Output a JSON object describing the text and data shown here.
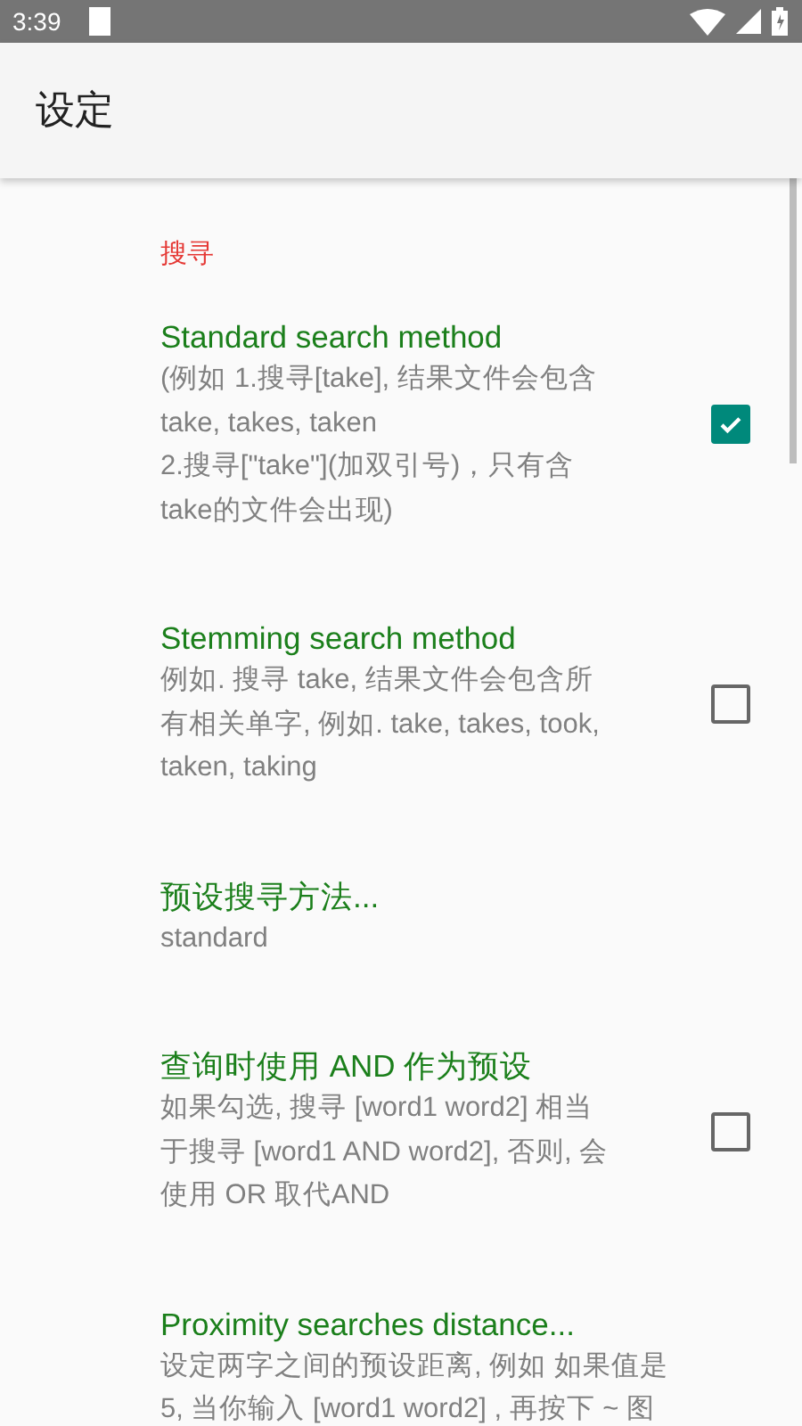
{
  "status_bar": {
    "time": "3:39"
  },
  "app_bar": {
    "title": "设定"
  },
  "category": "搜寻",
  "preferences": [
    {
      "kind": "checkbox",
      "title": "Standard search method",
      "summary": "(例如 1.搜寻[take], 结果文件会包含\ntake, takes, taken\n2.搜寻[\"take\"](加双引号)，只有含\ntake的文件会出现)",
      "checked": true
    },
    {
      "kind": "checkbox",
      "title": "Stemming search method",
      "summary": "例如. 搜寻 take, 结果文件会包含所有相关单字, 例如. take, takes, took,\ntaken, taking",
      "checked": false
    },
    {
      "kind": "list",
      "title": "预设搜寻方法...",
      "summary": "standard"
    },
    {
      "kind": "checkbox",
      "title": "查询时使用 AND 作为预设",
      "summary": "如果勾选, 搜寻 [word1 word2] 相当于搜寻 [word1 AND word2], 否则, 会使用 OR 取代AND",
      "checked": false
    },
    {
      "kind": "list",
      "title": "Proximity searches distance...",
      "summary": "设定两字之间的预设距离, 例如 如果值是5, 当你输入 [word1 word2] , 再按下 ~ 图"
    }
  ]
}
